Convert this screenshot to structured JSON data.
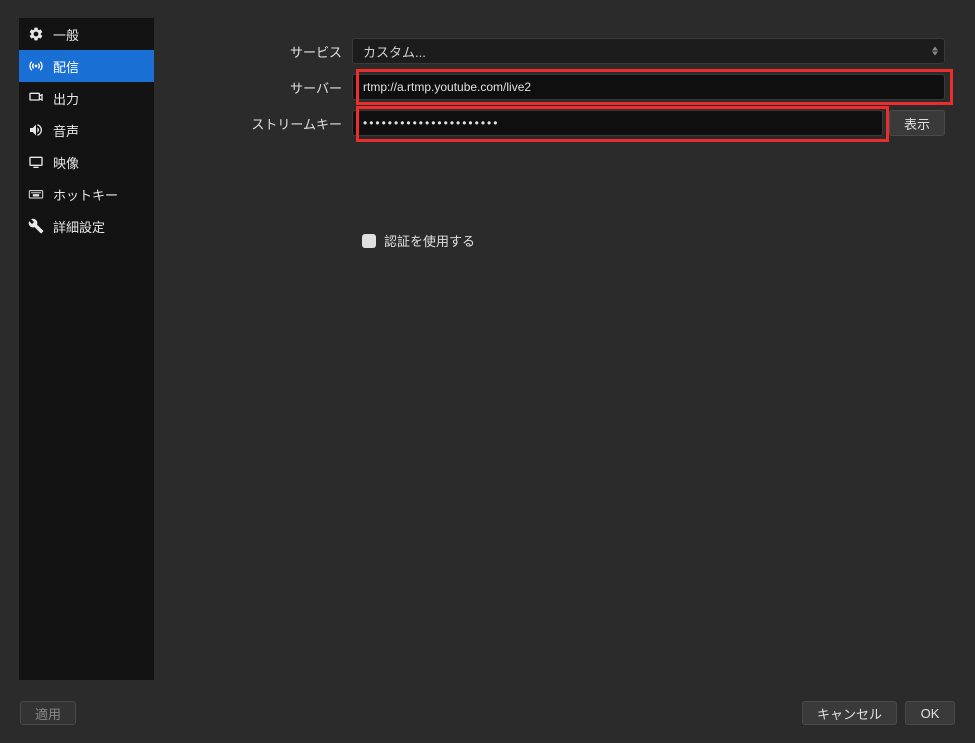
{
  "sidebar": {
    "items": [
      {
        "label": "一般"
      },
      {
        "label": "配信"
      },
      {
        "label": "出力"
      },
      {
        "label": "音声"
      },
      {
        "label": "映像"
      },
      {
        "label": "ホットキー"
      },
      {
        "label": "詳細設定"
      }
    ]
  },
  "form": {
    "service_label": "サービス",
    "service_value": "カスタム...",
    "server_label": "サーバー",
    "server_value": "rtmp://a.rtmp.youtube.com/live2",
    "streamkey_label": "ストリームキー",
    "streamkey_value": "••••••••••••••••••••••",
    "show_button": "表示",
    "auth_checkbox": "認証を使用する"
  },
  "footer": {
    "apply": "適用",
    "cancel": "キャンセル",
    "ok": "OK"
  }
}
